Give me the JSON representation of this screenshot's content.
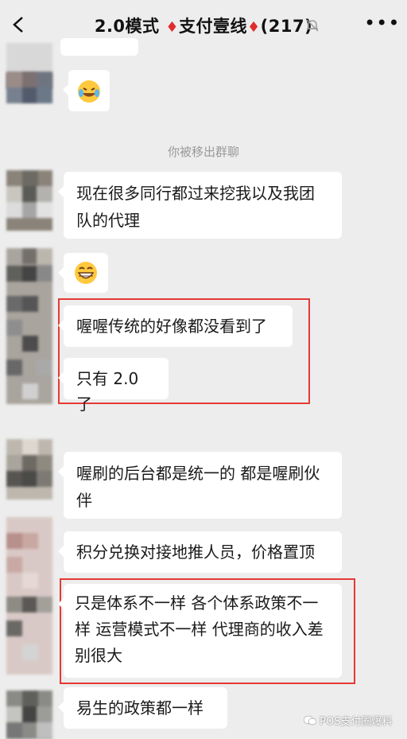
{
  "header": {
    "title_prefix": "2.0模式 ",
    "diamond": "♦",
    "title_mid": "支付壹线",
    "title_count": "(217)"
  },
  "system_notice": "你被移出群聊",
  "messages": [
    {
      "text": "现在很多同行都过来挖我以及我团队的代理"
    },
    {
      "text": "喔喔传统的好像都没看到了"
    },
    {
      "text": "只有 2.0 了"
    },
    {
      "text": "喔刷的后台都是统一的 都是喔刷伙伴"
    },
    {
      "text": "积分兑换对接地推人员，价格置顶"
    },
    {
      "text": "只是体系不一样 各个体系政策不一样 运营模式不一样 代理商的收入差别很大"
    },
    {
      "text": "易生的政策都一样"
    }
  ],
  "watermark": "POS支付圈爆料",
  "colors": {
    "highlight_border": "#e53935",
    "background": "#ededed"
  }
}
